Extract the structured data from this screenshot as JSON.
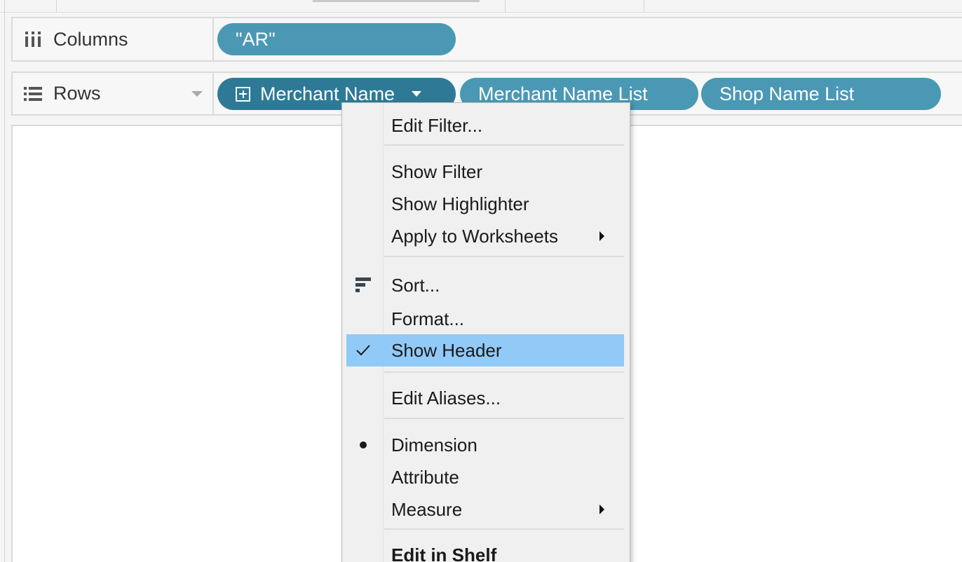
{
  "shelves": {
    "columns": {
      "label": "Columns",
      "icon": "columns-icon",
      "pills": [
        {
          "label": "\"AR\""
        }
      ]
    },
    "rows": {
      "label": "Rows",
      "icon": "rows-icon",
      "pills": [
        {
          "label": "Merchant Name",
          "expand_icon": "plus-square-icon",
          "has_dropdown": true,
          "active": true
        },
        {
          "label": "Merchant Name List"
        },
        {
          "label": "Shop Name List"
        }
      ]
    }
  },
  "context_menu": {
    "items": [
      {
        "label": "Edit Filter..."
      },
      {
        "label": "Show Filter"
      },
      {
        "label": "Show Highlighter"
      },
      {
        "label": "Apply to Worksheets",
        "submenu": true
      },
      {
        "label": "Sort...",
        "icon": "sort-icon"
      },
      {
        "label": "Format..."
      },
      {
        "label": "Show Header",
        "checked": true,
        "highlighted": true
      },
      {
        "label": "Edit Aliases..."
      },
      {
        "label": "Dimension",
        "selected_bullet": true
      },
      {
        "label": "Attribute"
      },
      {
        "label": "Measure",
        "submenu": true
      },
      {
        "label": "Edit in Shelf",
        "bold": true
      }
    ]
  },
  "colors": {
    "pill": "#4a98b4",
    "pill_active": "#2e7a96",
    "menu_highlight": "#91c9f7",
    "menu_background": "#f0f0f0"
  }
}
